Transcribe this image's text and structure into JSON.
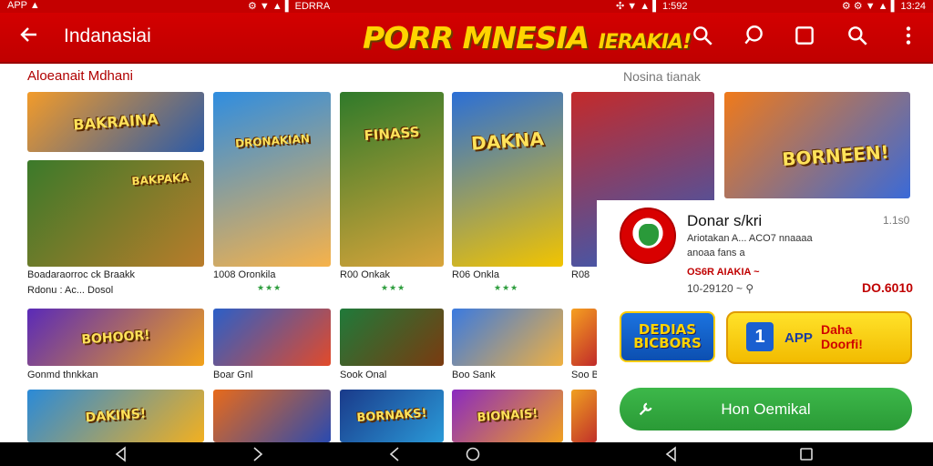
{
  "status": {
    "left": "APP ▲",
    "mid": "⚙ ▼ ▲ ▌ EDRRA",
    "mid2": "✣ ▼ ▲ ▌ 1:592",
    "right": "⚙ ⚙ ▼ ▲ ▌ 13:24"
  },
  "appbar": {
    "title": "Indanasiai",
    "brand_main": "PORR MNESIA ",
    "brand_small": "IERAKIA!"
  },
  "icons": [
    "back-arrow-icon",
    "search-icon",
    "chat-icon",
    "square-icon",
    "search-icon",
    "more-vert-icon"
  ],
  "sections": {
    "left": "Aloeanait Mdhani",
    "right": "Nosina tianak"
  },
  "tiles": [
    {
      "label": "",
      "bg1": "#f29b2a",
      "bg2": "#2b5aa8"
    },
    {
      "label": "",
      "bg1": "#3b7a2a",
      "bg2": "#b97c2a"
    },
    {
      "label": "",
      "bg1": "#2f8de0",
      "bg2": "#f6b24a"
    },
    {
      "label": "FINASS",
      "bg1": "#2f7a2a",
      "bg2": "#d9a43a"
    },
    {
      "label": "DAKNA",
      "bg1": "#2b6fd6",
      "bg2": "#f2c400"
    },
    {
      "label": "",
      "bg1": "#c42a2a",
      "bg2": "#2e5fbf"
    },
    {
      "label": "BORNEEN!",
      "bg1": "#f07a1a",
      "bg2": "#3a6ad8"
    }
  ],
  "captions": {
    "row1a": "Boadaraorroc ck Braakk",
    "row1b": "Rdonu : Ac... Dosol",
    "t2": "1008 Oronkila",
    "t3": "R00 Onkak",
    "t4": "R06 Onkla",
    "t5": "R08",
    "row2a": "Gonmd thnkkan",
    "row2b": "Boar Gnl",
    "row2c": "Sook Onal",
    "row2d": "Boo Sank",
    "row2e": "Soo Bold"
  },
  "row2_tiles": [
    {
      "label": "BOHOOR!",
      "bg1": "#5a2ab8",
      "bg2": "#f2a21a"
    },
    {
      "label": "",
      "bg1": "#2b5fc8",
      "bg2": "#e24a2a"
    },
    {
      "label": "",
      "bg1": "#1f7a3a",
      "bg2": "#7a3a10"
    },
    {
      "label": "",
      "bg1": "#3a7ae0",
      "bg2": "#f0b040"
    },
    {
      "label": "",
      "bg1": "#f6a020",
      "bg2": "#c02a2a"
    }
  ],
  "row3_tiles": [
    {
      "label": "DAKINS!",
      "bg1": "#2a8ad8",
      "bg2": "#f2b020"
    },
    {
      "label": "",
      "bg1": "#e86a1a",
      "bg2": "#2a4ab0"
    },
    {
      "label": "BORNAKS!",
      "bg1": "#1a3a8a",
      "bg2": "#2a9ad8"
    },
    {
      "label": "BIONAIS!",
      "bg1": "#8a2ac0",
      "bg2": "#f0a020"
    },
    {
      "label": "",
      "bg1": "#f0a020",
      "bg2": "#c0302a"
    }
  ],
  "detail": {
    "name": "Donar s/kri",
    "count": "1.1s0",
    "desc1": "Ariotakan A... ACO7 nnaaaa",
    "desc2": "anoaa fans a",
    "meta": "OS6R AIAKIA ~",
    "meta2": "10-29120 ~ ⚲",
    "price": "DO.6010"
  },
  "buttons": {
    "blue_label": "DEDIAS BICBORS",
    "yellow_app": "APP",
    "yellow_line1": "Daha",
    "yellow_line2": "Doorfi!",
    "green_label": "Hon Oemikal"
  }
}
